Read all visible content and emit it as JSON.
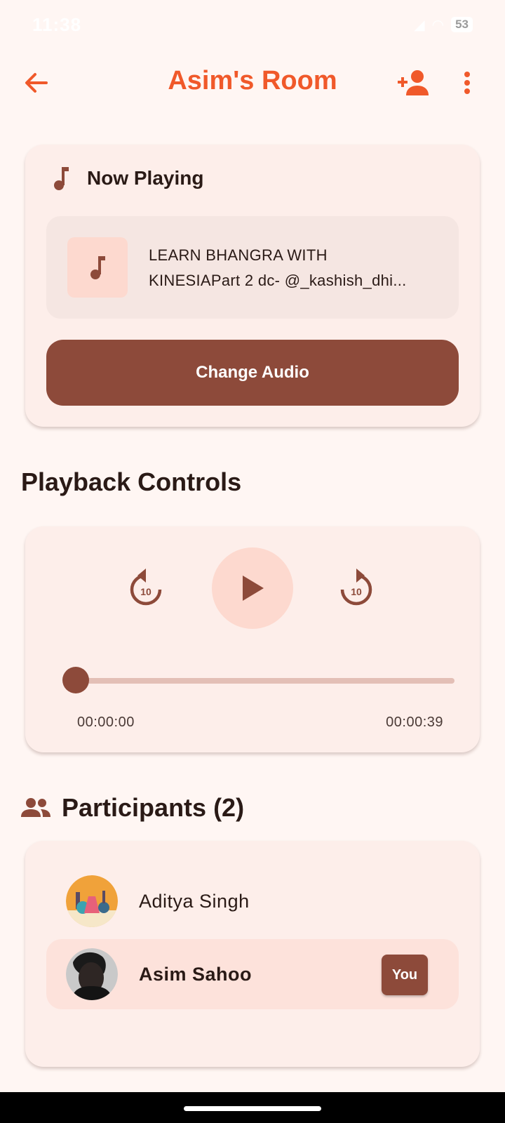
{
  "status_bar": {
    "time": "11:38",
    "battery": "53"
  },
  "app_bar": {
    "title": "Asim's Room"
  },
  "now_playing": {
    "header": "Now Playing",
    "track_title_line1": "LEARN BHANGRA WITH",
    "track_title_line2": "KINESIAPart 2 dc- @_kashish_dhi...",
    "change_audio_label": "Change Audio"
  },
  "playback": {
    "section_title": "Playback Controls",
    "rewind_seconds": "10",
    "forward_seconds": "10",
    "current_time": "00:00:00",
    "total_time": "00:00:39",
    "progress_fraction": 0
  },
  "participants": {
    "title": "Participants (2)",
    "list": [
      {
        "name": "Aditya Singh"
      },
      {
        "name": "Asim Sahoo",
        "badge": "You"
      }
    ]
  },
  "colors": {
    "accent": "#f0592a",
    "primary": "#8d4a3a",
    "background": "#fff6f3",
    "card": "#fdeeea"
  }
}
